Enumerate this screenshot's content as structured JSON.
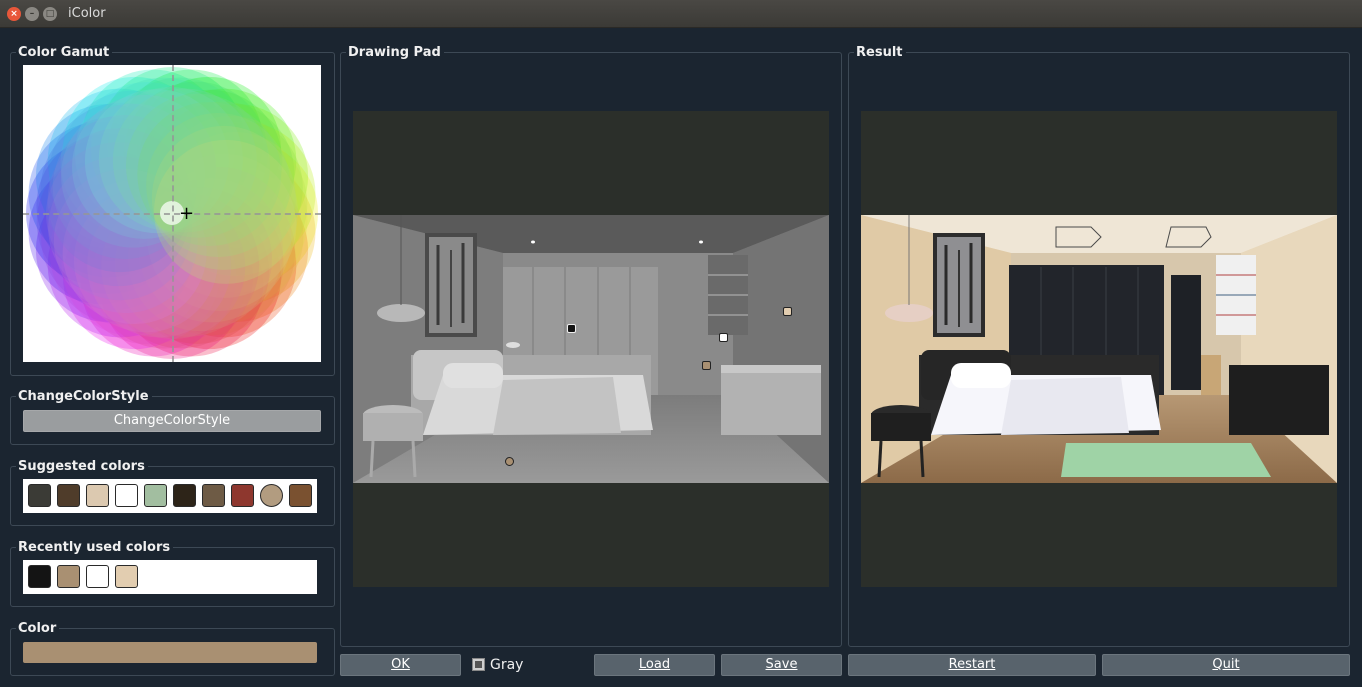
{
  "window": {
    "title": "iColor",
    "close_glyph": "×",
    "min_glyph": "–",
    "max_glyph": "□"
  },
  "panels": {
    "color_gamut": "Color Gamut",
    "drawing_pad": "Drawing Pad",
    "result": "Result",
    "change_color_style": "ChangeColorStyle",
    "suggested_colors": "Suggested colors",
    "recently_used_colors": "Recently used colors",
    "color": "Color"
  },
  "buttons": {
    "change_style": "ChangeColorStyle",
    "ok": "OK",
    "load": "Load",
    "save": "Save",
    "restart": "Restart",
    "quit": "Quit"
  },
  "gray_checkbox": {
    "label": "Gray",
    "checked": true
  },
  "suggested_colors": [
    "#3b3b36",
    "#4f3c2a",
    "#dcc9b0",
    "#ffffff",
    "#a2bea0",
    "#2d2418",
    "#6e5b45",
    "#8e372e",
    "#b29c80",
    "#7a5130"
  ],
  "recent_colors": [
    "#141414",
    "#a99072",
    "#ffffff",
    "#e2cdb0"
  ],
  "current_color": "#a99072",
  "icons": {
    "cursor": "crosshair-plus-icon"
  }
}
